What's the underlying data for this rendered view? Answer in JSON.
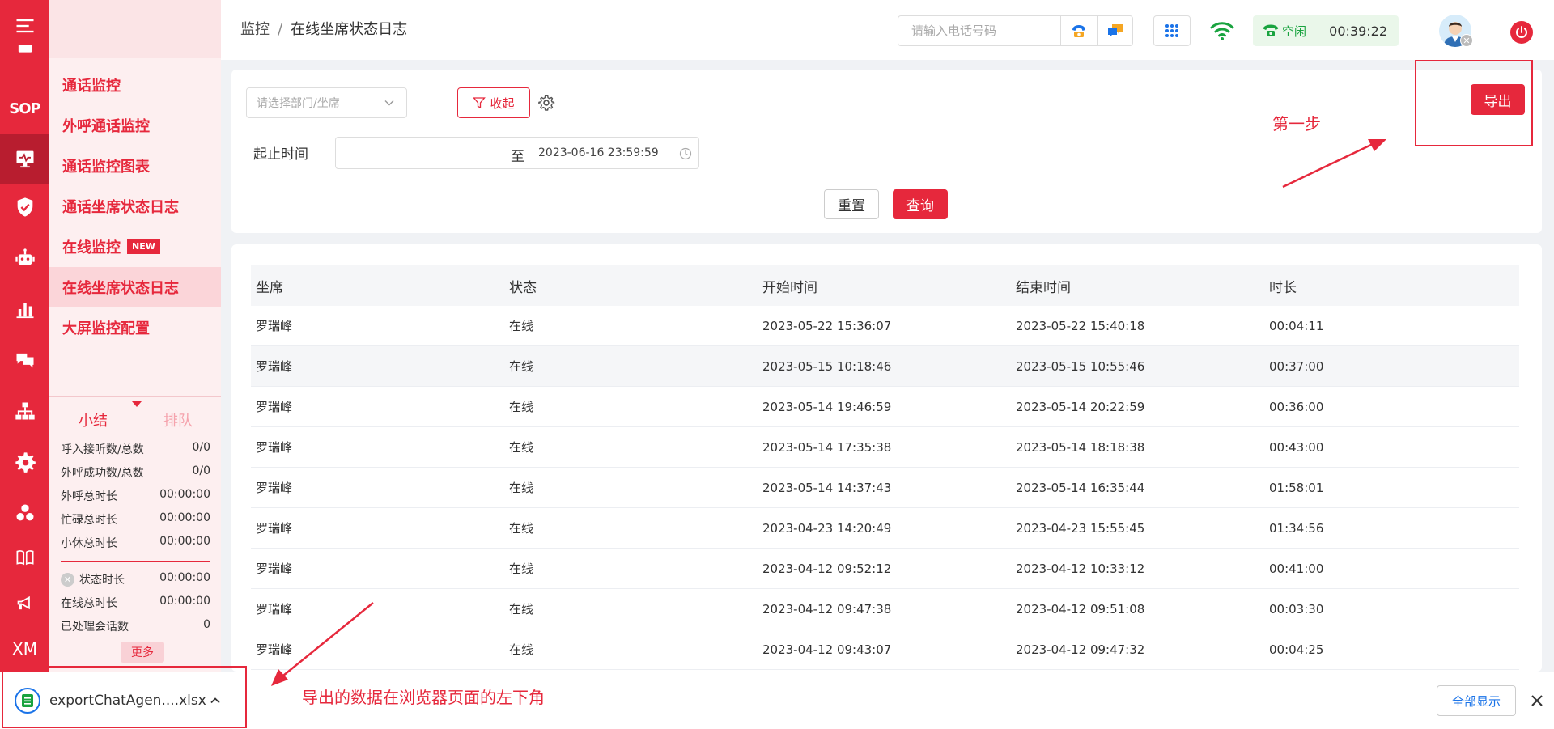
{
  "rail": {
    "sop_label": "SOP",
    "xm_label": "XM"
  },
  "submenu": {
    "items": [
      {
        "label": "通话监控"
      },
      {
        "label": "外呼通话监控"
      },
      {
        "label": "通话监控图表"
      },
      {
        "label": "通话坐席状态日志"
      },
      {
        "label": "在线监控",
        "badge": "NEW"
      },
      {
        "label": "在线坐席状态日志"
      },
      {
        "label": "大屏监控配置"
      }
    ],
    "active_index": 5
  },
  "summary": {
    "tab_summary": "小结",
    "tab_queue": "排队",
    "stats": [
      {
        "label": "呼入接听数/总数",
        "value": "0/0"
      },
      {
        "label": "外呼成功数/总数",
        "value": "0/0"
      },
      {
        "label": "外呼总时长",
        "value": "00:00:00"
      },
      {
        "label": "忙碌总时长",
        "value": "00:00:00"
      },
      {
        "label": "小休总时长",
        "value": "00:00:00"
      },
      {
        "label": "状态时长",
        "value": "00:00:00"
      },
      {
        "label": "在线总时长",
        "value": "00:00:00"
      },
      {
        "label": "已处理会话数",
        "value": "0"
      }
    ],
    "more": "更多"
  },
  "header": {
    "breadcrumb_parent": "监控",
    "breadcrumb_sep": "/",
    "breadcrumb_current": "在线坐席状态日志",
    "phone_placeholder": "请输入电话号码",
    "status": "空闲",
    "timer": "00:39:22"
  },
  "filter": {
    "dept_placeholder": "请选择部门/坐席",
    "collapse_label": "收起",
    "time_label": "起止时间",
    "range_to": "至",
    "range_end": "2023-06-16 23:59:59",
    "reset_label": "重置",
    "query_label": "查询",
    "export_label": "导出"
  },
  "table": {
    "headers": [
      "坐席",
      "状态",
      "开始时间",
      "结束时间",
      "时长"
    ],
    "rows": [
      [
        "罗瑞峰",
        "在线",
        "2023-05-22 15:36:07",
        "2023-05-22 15:40:18",
        "00:04:11"
      ],
      [
        "罗瑞峰",
        "在线",
        "2023-05-15 10:18:46",
        "2023-05-15 10:55:46",
        "00:37:00"
      ],
      [
        "罗瑞峰",
        "在线",
        "2023-05-14 19:46:59",
        "2023-05-14 20:22:59",
        "00:36:00"
      ],
      [
        "罗瑞峰",
        "在线",
        "2023-05-14 17:35:38",
        "2023-05-14 18:18:38",
        "00:43:00"
      ],
      [
        "罗瑞峰",
        "在线",
        "2023-05-14 14:37:43",
        "2023-05-14 16:35:44",
        "01:58:01"
      ],
      [
        "罗瑞峰",
        "在线",
        "2023-04-23 14:20:49",
        "2023-04-23 15:55:45",
        "01:34:56"
      ],
      [
        "罗瑞峰",
        "在线",
        "2023-04-12 09:52:12",
        "2023-04-12 10:33:12",
        "00:41:00"
      ],
      [
        "罗瑞峰",
        "在线",
        "2023-04-12 09:47:38",
        "2023-04-12 09:51:08",
        "00:03:30"
      ],
      [
        "罗瑞峰",
        "在线",
        "2023-04-12 09:43:07",
        "2023-04-12 09:47:32",
        "00:04:25"
      ]
    ]
  },
  "downloads": {
    "file_name": "exportChatAgen....xlsx",
    "show_all": "全部显示"
  },
  "annotations": {
    "step1": "第一步",
    "note": "导出的数据在浏览器页面的左下角"
  },
  "colors": {
    "brand": "#e6283c",
    "idle_green": "#19a33f",
    "link_blue": "#1a73e8"
  }
}
